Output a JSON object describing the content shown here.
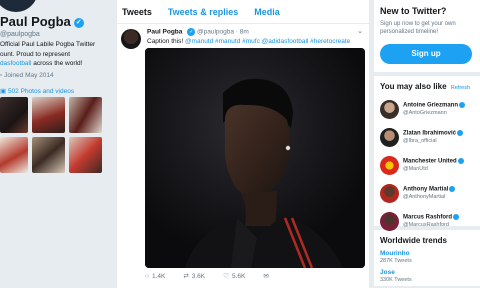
{
  "profile": {
    "name": "Paul Pogba",
    "handle": "@paulpogba",
    "bio_line1": "Official Paul Labile Pogba Twitter",
    "bio_line2": "ount. Proud to represent",
    "bio_tag": "dasfootball",
    "bio_end": " across the world!",
    "joined": "Joined May 2014",
    "photos_link": "502 Photos and videos"
  },
  "tabs": [
    "Tweets",
    "Tweets & replies",
    "Media"
  ],
  "tweet": {
    "author": "Paul Pogba",
    "handle_time": "@paulpogba · 8m",
    "text": "Caption this!",
    "hashtags": " @manutd #manutd #mufc @adidasfootball #heretocreate",
    "replies": "1.4K",
    "retweets": "3.6K",
    "likes": "5.6K"
  },
  "new_to_twitter": {
    "title": "New to Twitter?",
    "subtitle": "Sign up now to get your own personalized timeline!",
    "button": "Sign up"
  },
  "also_like": {
    "title": "You may also like",
    "refresh": "Refresh",
    "people": [
      {
        "name": "Antoine Griezmann",
        "handle": "@AntoGriezmann"
      },
      {
        "name": "Zlatan Ibrahimović",
        "handle": "@Ibra_official"
      },
      {
        "name": "Manchester United",
        "handle": "@ManUtd"
      },
      {
        "name": "Anthony Martial",
        "handle": "@AnthonyMartial"
      },
      {
        "name": "Marcus Rashford",
        "handle": "@MarcusRashford"
      }
    ]
  },
  "trends": {
    "title": "Worldwide trends",
    "items": [
      {
        "name": "Mourinho",
        "count": "287K Tweets"
      },
      {
        "name": "Jose",
        "count": "330K Tweets"
      }
    ]
  },
  "colors": {
    "accent": "#1da1f2",
    "link": "#1b95e0",
    "background": "#e6ecf0"
  }
}
